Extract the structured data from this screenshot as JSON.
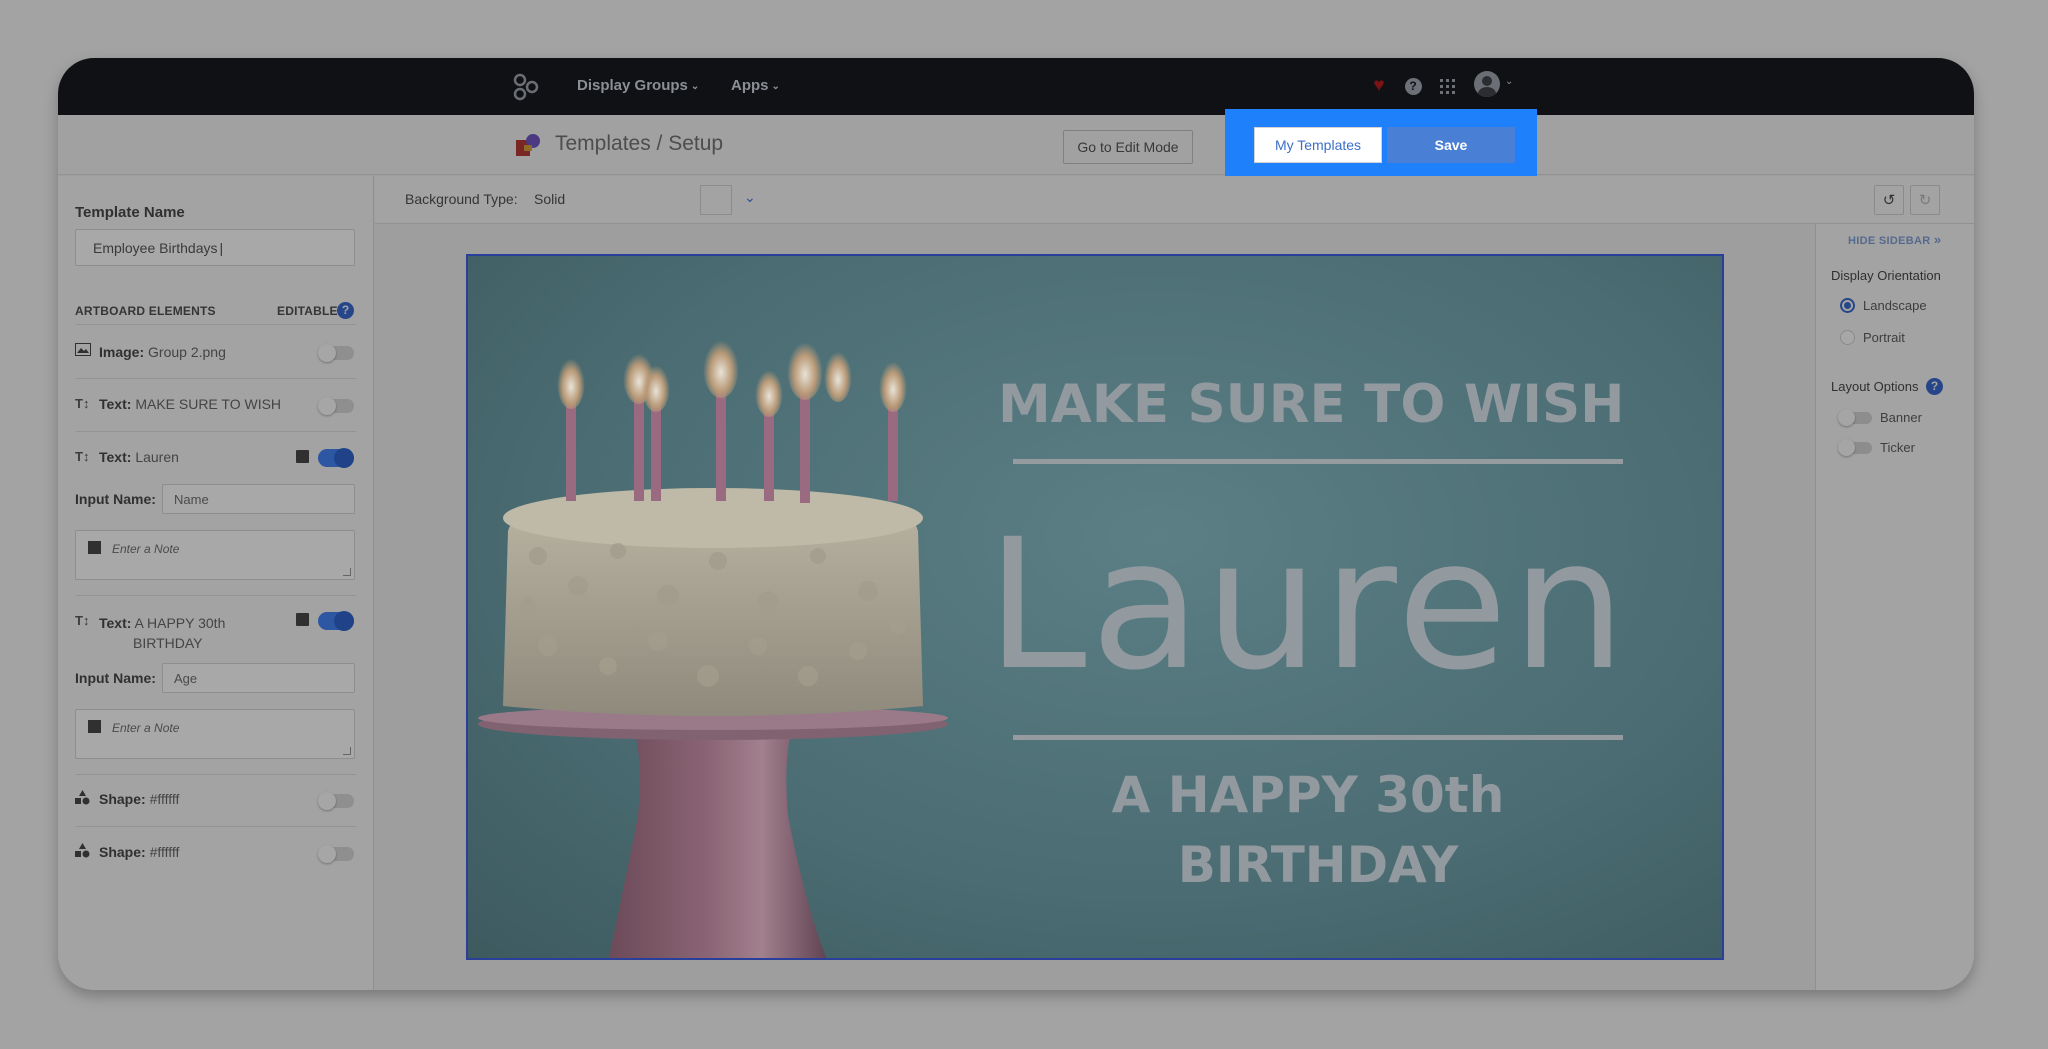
{
  "nav": {
    "display_groups": "Display Groups",
    "apps": "Apps"
  },
  "header": {
    "title": "Templates / Setup",
    "edit_mode_label": "Go to Edit Mode",
    "my_templates_label": "My Templates",
    "save_label": "Save"
  },
  "sidebar": {
    "template_name_label": "Template Name",
    "template_name_value": "Employee Birthdays",
    "artboard_elements_label": "ARTBOARD ELEMENTS",
    "editable_label": "EDITABLE",
    "elements": [
      {
        "type": "Image:",
        "value": "Group 2.png",
        "editable": false
      },
      {
        "type": "Text:",
        "value": "MAKE SURE TO WISH",
        "editable": false
      },
      {
        "type": "Text:",
        "value": "Lauren",
        "editable": true,
        "input_name_label": "Input Name:",
        "input_name_placeholder": "Name",
        "note_placeholder": "Enter a Note"
      },
      {
        "type": "Text:",
        "value_line1": "A HAPPY 30th",
        "value_line2": "BIRTHDAY",
        "editable": true,
        "input_name_label": "Input Name:",
        "input_name_placeholder": "Age",
        "note_placeholder": "Enter a Note"
      },
      {
        "type": "Shape:",
        "value": "#ffffff",
        "editable": false
      },
      {
        "type": "Shape:",
        "value": "#ffffff",
        "editable": false
      }
    ]
  },
  "toolbar": {
    "background_type_label": "Background Type:",
    "background_type_value": "Solid"
  },
  "artboard": {
    "line1": "MAKE SURE TO WISH",
    "name": "Lauren",
    "line3": "A HAPPY 30th",
    "line4": "BIRTHDAY"
  },
  "right_sidebar": {
    "hide_label": "HIDE SIDEBAR",
    "orientation_label": "Display Orientation",
    "landscape": "Landscape",
    "portrait": "Portrait",
    "selected_orientation": "Landscape",
    "layout_options_label": "Layout Options",
    "banner": "Banner",
    "ticker": "Ticker"
  },
  "colors": {
    "save_button": "#4a7fd6",
    "highlight": "#1e80fa",
    "toggle_on": "#2d57a3"
  }
}
